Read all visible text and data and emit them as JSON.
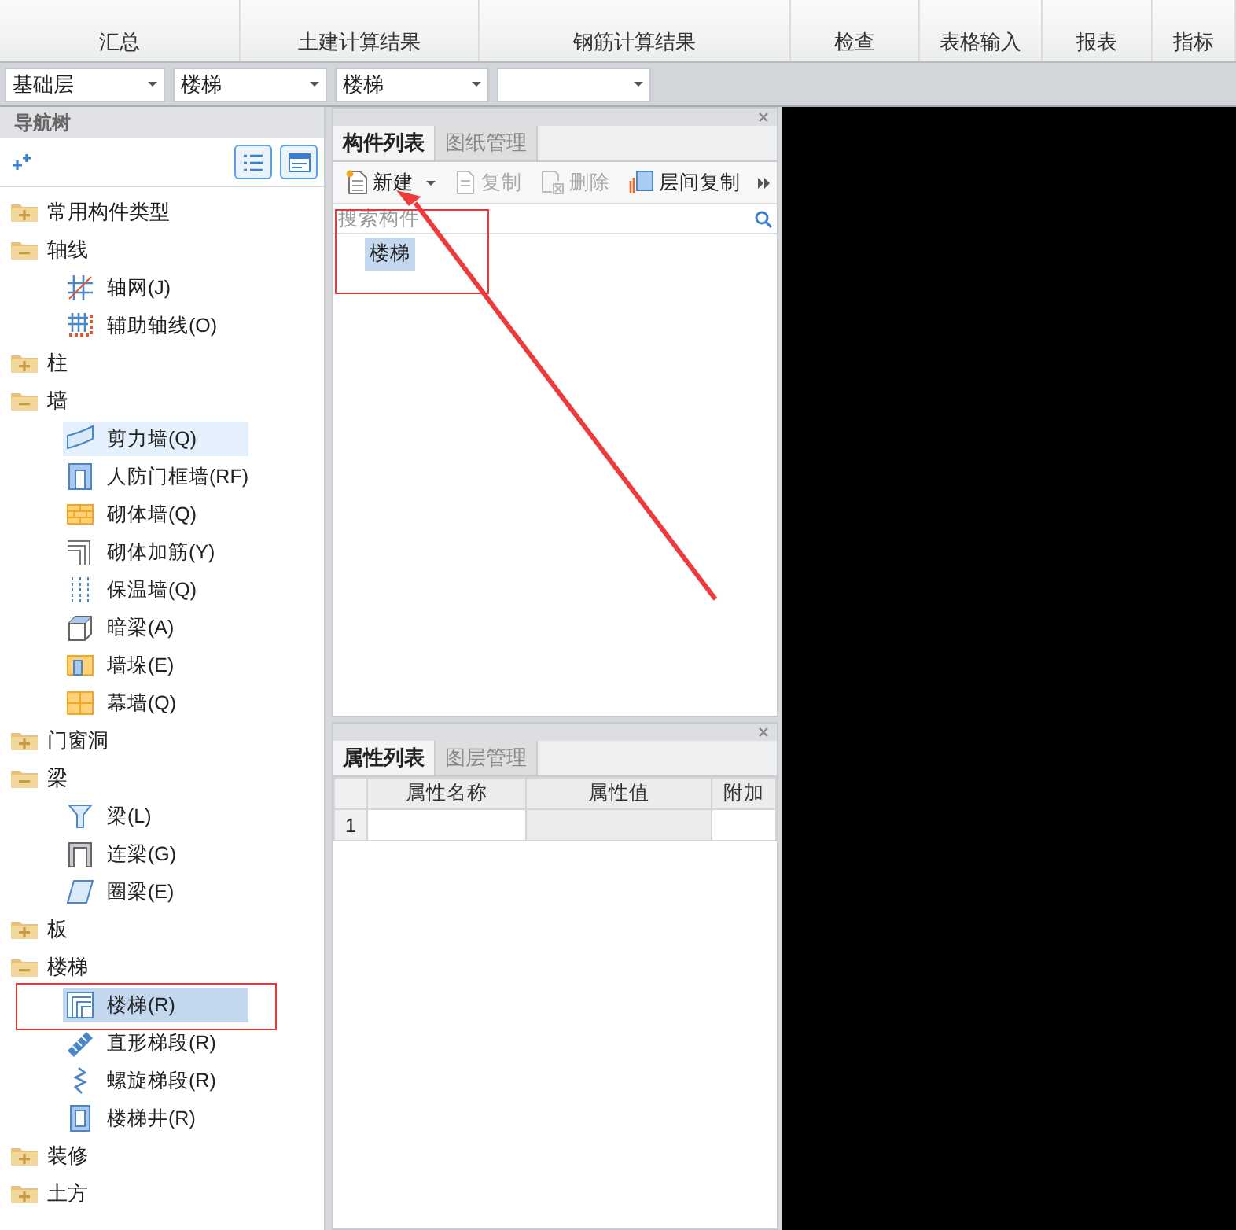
{
  "ribbon": {
    "tabs": [
      {
        "label": "汇总"
      },
      {
        "label": "土建计算结果"
      },
      {
        "label": "钢筋计算结果"
      },
      {
        "label": "检查"
      },
      {
        "label": "表格输入"
      },
      {
        "label": "报表"
      },
      {
        "label": "指标"
      }
    ]
  },
  "selectors": [
    {
      "kind": "filled",
      "value": "基础层"
    },
    {
      "kind": "filled",
      "value": "楼梯"
    },
    {
      "kind": "filled",
      "value": "楼梯"
    },
    {
      "kind": "blank"
    }
  ],
  "nav": {
    "title": "导航树",
    "tree": [
      {
        "label": "常用构件类型",
        "expanded": false
      },
      {
        "label": "轴线",
        "expanded": true,
        "children": [
          {
            "label": "轴网(J)",
            "kind": "grid",
            "selected": false,
            "hovered": false
          },
          {
            "label": "辅助轴线(O)",
            "kind": "auxgrid",
            "selected": false,
            "hovered": false
          }
        ]
      },
      {
        "label": "柱",
        "expanded": false
      },
      {
        "label": "墙",
        "expanded": true,
        "children": [
          {
            "label": "剪力墙(Q)",
            "kind": "shearwall",
            "selected": false,
            "hovered": true
          },
          {
            "label": "人防门框墙(RF)",
            "kind": "frame",
            "selected": false,
            "hovered": false
          },
          {
            "label": "砌体墙(Q)",
            "kind": "brick",
            "selected": false,
            "hovered": false
          },
          {
            "label": "砌体加筋(Y)",
            "kind": "rebar",
            "selected": false,
            "hovered": false
          },
          {
            "label": "保温墙(Q)",
            "kind": "insul",
            "selected": false,
            "hovered": false
          },
          {
            "label": "暗梁(A)",
            "kind": "box",
            "selected": false,
            "hovered": false
          },
          {
            "label": "墙垛(E)",
            "kind": "pier",
            "selected": false,
            "hovered": false
          },
          {
            "label": "幕墙(Q)",
            "kind": "curtain",
            "selected": false,
            "hovered": false
          }
        ]
      },
      {
        "label": "门窗洞",
        "expanded": false
      },
      {
        "label": "梁",
        "expanded": true,
        "children": [
          {
            "label": "梁(L)",
            "kind": "beam",
            "selected": false,
            "hovered": false
          },
          {
            "label": "连梁(G)",
            "kind": "link",
            "selected": false,
            "hovered": false
          },
          {
            "label": "圈梁(E)",
            "kind": "ring",
            "selected": false,
            "hovered": false
          }
        ]
      },
      {
        "label": "板",
        "expanded": false
      },
      {
        "label": "楼梯",
        "expanded": true,
        "children": [
          {
            "label": "楼梯(R)",
            "kind": "stair",
            "selected": true,
            "hovered": false
          },
          {
            "label": "直形梯段(R)",
            "kind": "flight",
            "selected": false,
            "hovered": false
          },
          {
            "label": "螺旋梯段(R)",
            "kind": "spiral",
            "selected": false,
            "hovered": false
          },
          {
            "label": "楼梯井(R)",
            "kind": "well",
            "selected": false,
            "hovered": false
          }
        ]
      },
      {
        "label": "装修",
        "expanded": false
      },
      {
        "label": "土方",
        "expanded": false
      }
    ]
  },
  "component_panel": {
    "tabs": [
      {
        "label": "构件列表",
        "selected": true
      },
      {
        "label": "图纸管理",
        "selected": false
      }
    ],
    "toolbar": [
      {
        "label": "新建",
        "kind": "new",
        "disabled": false
      },
      {
        "label": "复制",
        "kind": "copy",
        "disabled": true
      },
      {
        "label": "删除",
        "kind": "delete",
        "disabled": true
      },
      {
        "label": "层间复制",
        "kind": "floorcopy",
        "disabled": false
      }
    ],
    "search": {
      "placeholder": "搜索构件"
    },
    "items": [
      {
        "label": "楼梯",
        "selected": true
      }
    ]
  },
  "property_panel": {
    "tabs": [
      {
        "label": "属性列表",
        "selected": true
      },
      {
        "label": "图层管理",
        "selected": false
      }
    ],
    "columns": [
      "属性名称",
      "属性值",
      "附加"
    ],
    "rows": [
      {
        "index": "1"
      }
    ]
  }
}
